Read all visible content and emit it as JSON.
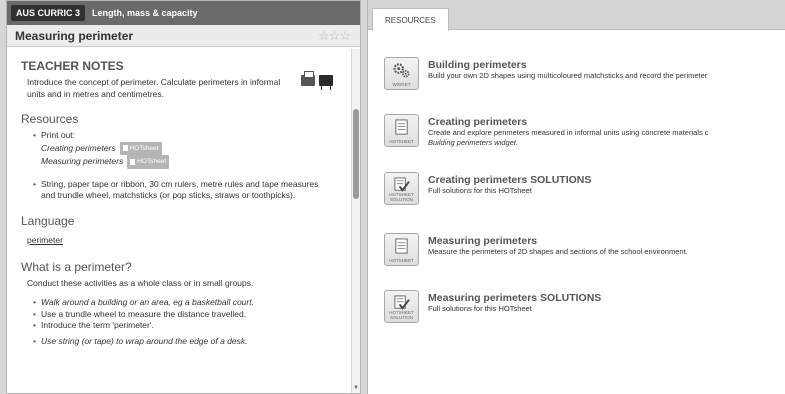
{
  "left": {
    "curric_tag": "AUS CURRIC 3",
    "curric_path": "Length, mass & capacity",
    "title": "Measuring perimeter",
    "teacher_notes_heading": "TEACHER NOTES",
    "teacher_notes_text": "Introduce the concept of perimeter. Calculate perimeters in informal units and in metres and centimetres.",
    "resources_heading": "Resources",
    "print_out_label": "Print out:",
    "printouts": [
      {
        "name": "Creating perimeters",
        "badge": "HOTsheet"
      },
      {
        "name": "Measuring perimeters",
        "badge": "HOTsheet"
      }
    ],
    "materials": "String, paper tape or ribbon, 30 cm rulers, metre rules and tape measures and trundle wheel, matchsticks (or pop sticks, straws or toothpicks).",
    "language_heading": "Language",
    "language_link": "perimeter",
    "what_heading": "What is a perimeter?",
    "what_text": "Conduct these activities as a whole class or in small groups.",
    "activities": [
      "Walk around a building or an area, eg a basketball court.",
      "Use a trundle wheel to measure the distance travelled.",
      "Introduce the term 'perimeter'.",
      "Use string (or tape) to wrap around the edge of a desk."
    ]
  },
  "right": {
    "tab_label": "RESOURCES",
    "resources": [
      {
        "title": "Building perimeters",
        "desc": "Build your own 2D shapes using multicoloured matchsticks and record the perimeter",
        "type": "WIDGET",
        "icon": "gears-icon"
      },
      {
        "title": "Creating perimeters",
        "desc": "Create and explore perimeters measured in informal units using concrete materials c",
        "desc2": "Building perimeters widget.",
        "type": "HOTSHEET",
        "icon": "document-icon"
      },
      {
        "title": "Creating perimeters SOLUTIONS",
        "desc": "Full solutions for this HOTsheet",
        "type": "HOTSHEET SOLUTION",
        "icon": "checked-document-icon"
      },
      {
        "title": "Measuring perimeters",
        "desc": "Measure the perimeters of 2D shapes and sections of the school environment.",
        "type": "HOTSHEET",
        "icon": "document-icon"
      },
      {
        "title": "Measuring perimeters SOLUTIONS",
        "desc": "Full solutions for this HOTsheet",
        "type": "HOTSHEET SOLUTION",
        "icon": "checked-document-icon"
      }
    ]
  },
  "rating_stars": "☆☆☆"
}
